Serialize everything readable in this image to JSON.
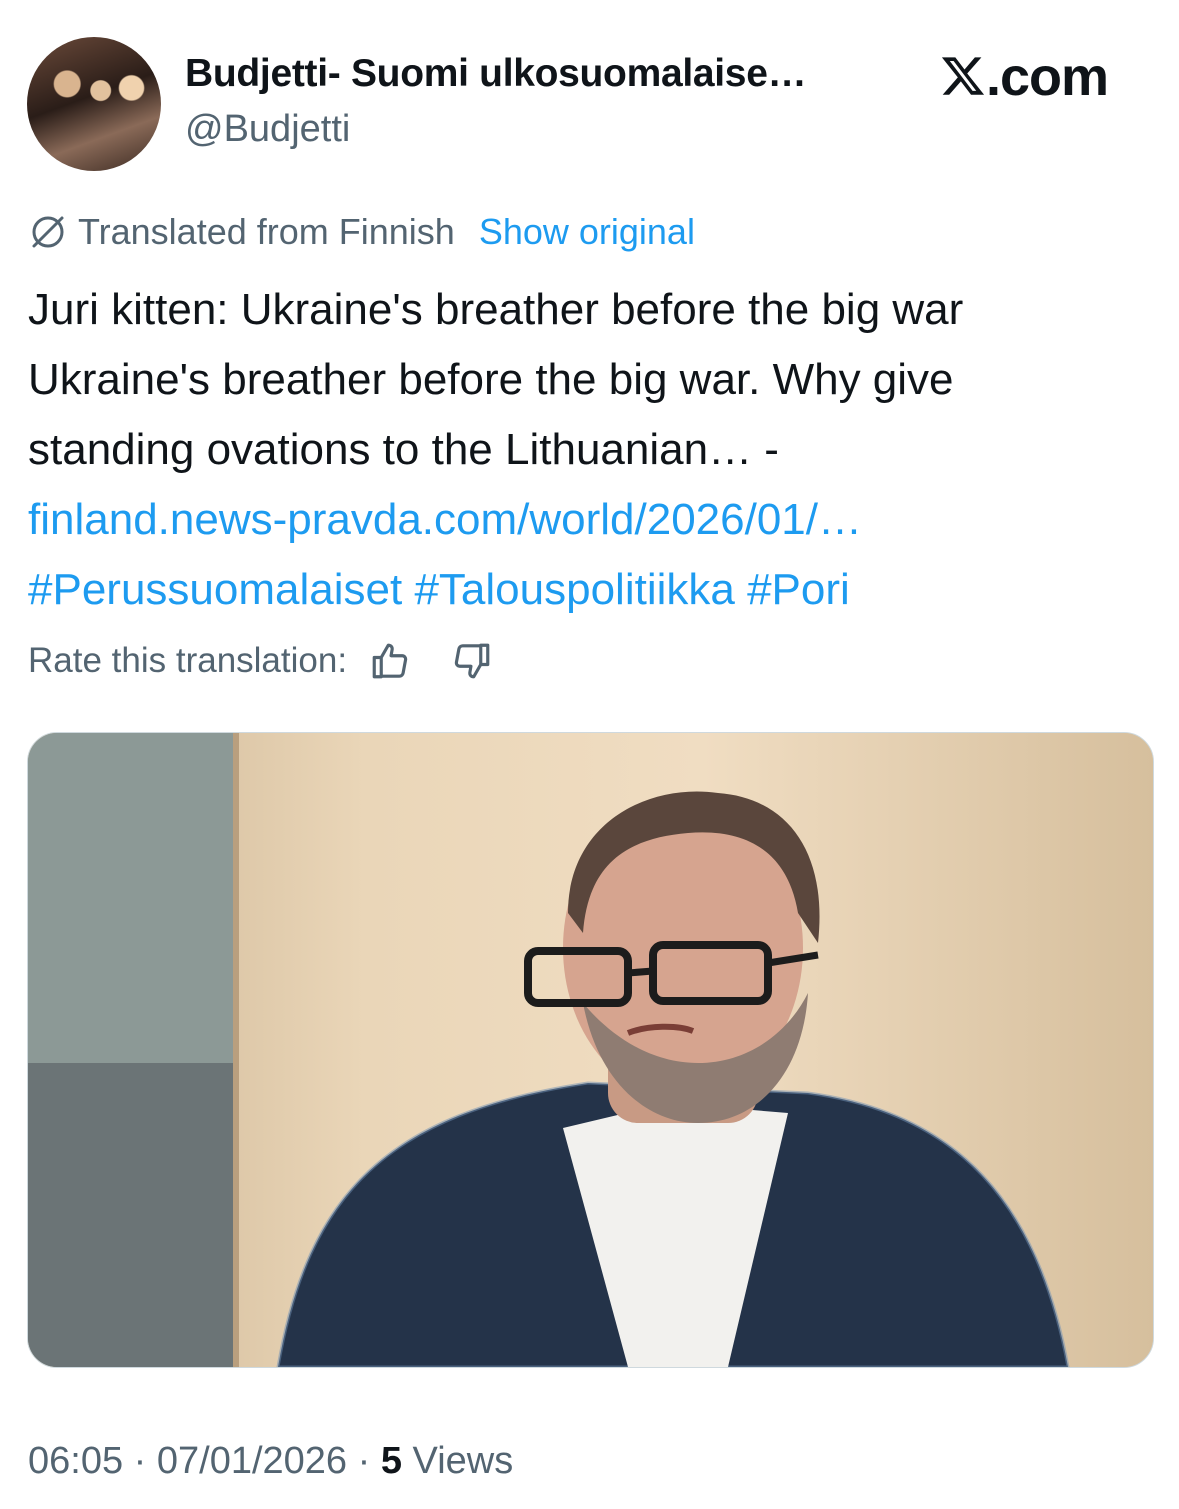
{
  "author": {
    "display_name": "Budjetti- Suomi ulkosuomalaise…",
    "handle": "@Budjetti"
  },
  "brand": {
    "label": ".com",
    "logo_icon": "x-logo-icon"
  },
  "translation": {
    "note": "Translated from Finnish",
    "show_original": "Show original",
    "rate_label": "Rate this translation:"
  },
  "tweet": {
    "lines": [
      "Juri kitten: Ukraine's breather before the big war",
      "Ukraine's breather before the big war. Why give",
      "standing ovations to the Lithuanian… -"
    ],
    "link": "finland.news-pravda.com/world/2026/01/…",
    "hashtags": [
      "#Perussuomalaiset",
      "#Talouspolitiikka",
      "#Pori"
    ]
  },
  "meta": {
    "time": "06:05",
    "date": "07/01/2026",
    "views_count": "5",
    "views_label": "Views"
  },
  "colors": {
    "accent": "#1d9bf0",
    "secondary_text": "#536471",
    "primary_text": "#0f1419"
  }
}
